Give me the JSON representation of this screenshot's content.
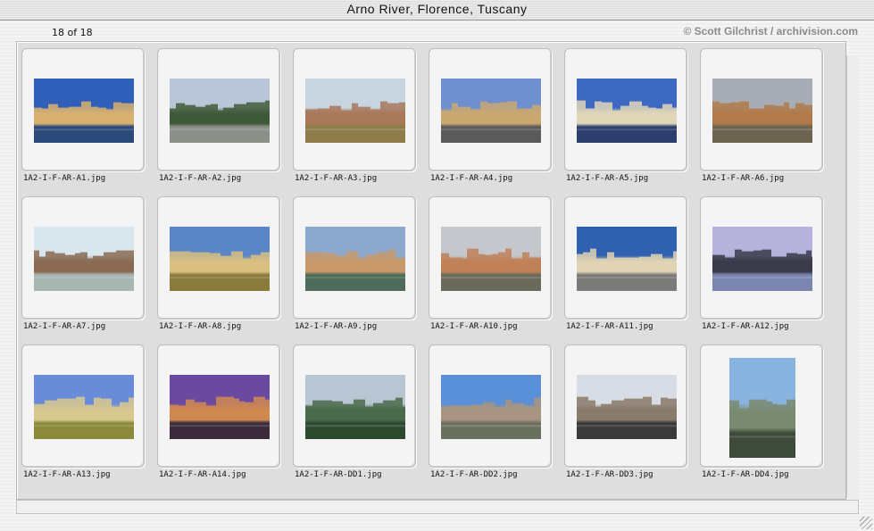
{
  "window": {
    "title": "Arno River, Florence, Tuscany"
  },
  "header": {
    "count_text": "18 of 18",
    "credit": "© Scott Gilchrist / archivision.com"
  },
  "gallery": {
    "items": [
      {
        "filename": "1A2-I-F-AR-A1.jpg",
        "sky": "#2f5fb8",
        "mid": "#d8b070",
        "water": "#2b4a7a",
        "orientation": "landscape"
      },
      {
        "filename": "1A2-I-F-AR-A2.jpg",
        "sky": "#b9c6d8",
        "mid": "#3f5a3a",
        "water": "#8a8f88",
        "orientation": "landscape"
      },
      {
        "filename": "1A2-I-F-AR-A3.jpg",
        "sky": "#c8d4e0",
        "mid": "#a8785a",
        "water": "#8e7c4a",
        "orientation": "landscape"
      },
      {
        "filename": "1A2-I-F-AR-A4.jpg",
        "sky": "#6f8fd0",
        "mid": "#c9a870",
        "water": "#5a5a5a",
        "orientation": "landscape"
      },
      {
        "filename": "1A2-I-F-AR-A5.jpg",
        "sky": "#3e69c2",
        "mid": "#e0d6b8",
        "water": "#2e3f6e",
        "orientation": "landscape"
      },
      {
        "filename": "1A2-I-F-AR-A6.jpg",
        "sky": "#a8acb4",
        "mid": "#b07a4a",
        "water": "#6c6450",
        "orientation": "landscape"
      },
      {
        "filename": "1A2-I-F-AR-A7.jpg",
        "sky": "#d8e6ee",
        "mid": "#8a6a52",
        "water": "#a7b6b0",
        "orientation": "landscape"
      },
      {
        "filename": "1A2-I-F-AR-A8.jpg",
        "sky": "#5a86c8",
        "mid": "#d8c080",
        "water": "#8a7a3c",
        "orientation": "landscape"
      },
      {
        "filename": "1A2-I-F-AR-A9.jpg",
        "sky": "#8ca8cc",
        "mid": "#c89a6a",
        "water": "#4e6a5a",
        "orientation": "landscape"
      },
      {
        "filename": "1A2-I-F-AR-A10.jpg",
        "sky": "#c4c8cc",
        "mid": "#c08058",
        "water": "#6a6a5a",
        "orientation": "landscape"
      },
      {
        "filename": "1A2-I-F-AR-A11.jpg",
        "sky": "#3060b0",
        "mid": "#e0d4b4",
        "water": "#7a7a78",
        "orientation": "landscape"
      },
      {
        "filename": "1A2-I-F-AR-A12.jpg",
        "sky": "#b6b2dc",
        "mid": "#3a3a4a",
        "water": "#7a86b0",
        "orientation": "landscape"
      },
      {
        "filename": "1A2-I-F-AR-A13.jpg",
        "sky": "#6a8cd8",
        "mid": "#d8c890",
        "water": "#8a8a3a",
        "orientation": "landscape"
      },
      {
        "filename": "1A2-I-F-AR-A14.jpg",
        "sky": "#6a4aa0",
        "mid": "#d08a50",
        "water": "#3a2a3a",
        "orientation": "landscape"
      },
      {
        "filename": "1A2-I-F-AR-DD1.jpg",
        "sky": "#b8c6d4",
        "mid": "#4a6a4a",
        "water": "#2e4a2e",
        "orientation": "landscape"
      },
      {
        "filename": "1A2-I-F-AR-DD2.jpg",
        "sky": "#5a90d8",
        "mid": "#a89480",
        "water": "#6a7060",
        "orientation": "landscape"
      },
      {
        "filename": "1A2-I-F-AR-DD3.jpg",
        "sky": "#d8dce4",
        "mid": "#8a7a6a",
        "water": "#3a3a3a",
        "orientation": "landscape"
      },
      {
        "filename": "1A2-I-F-AR-DD4.jpg",
        "sky": "#8ab4e0",
        "mid": "#7a8a70",
        "water": "#3e4a3a",
        "orientation": "portrait"
      }
    ]
  }
}
